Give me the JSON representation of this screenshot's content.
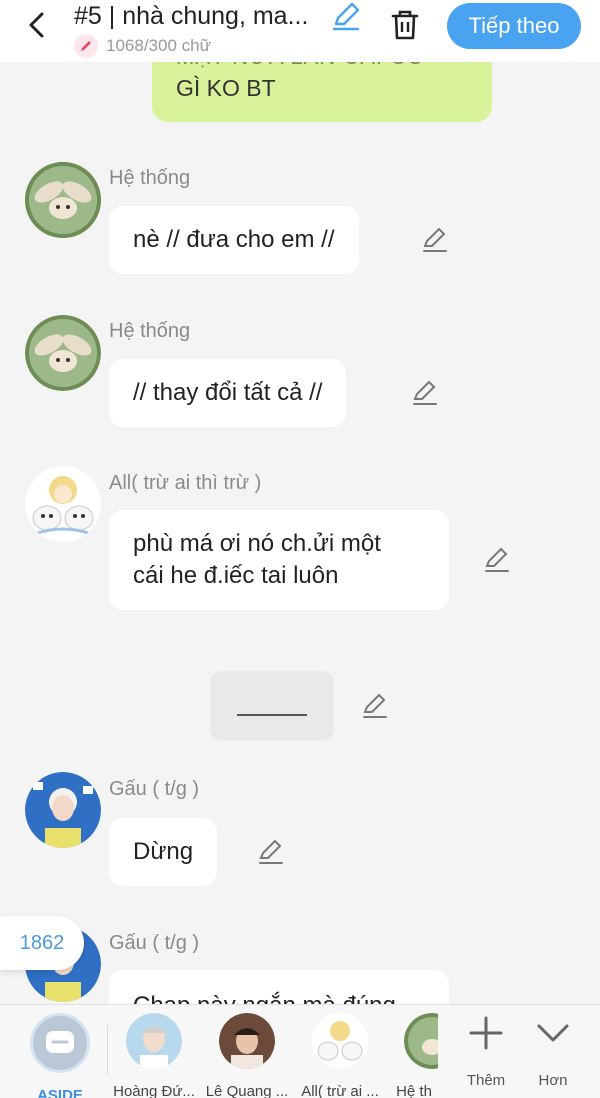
{
  "header": {
    "title": "#5 | nhà chung, ma...",
    "word_count": "1068/300 chữ",
    "next_button": "Tiếp theo"
  },
  "top_bubble": {
    "line1": "MẶT NỮA LẦN CÁI CÓ",
    "line2": "GÌ KO BT"
  },
  "messages": [
    {
      "name": "Hệ thống",
      "text": "nè // đưa cho em //"
    },
    {
      "name": "Hệ thống",
      "text": "// thay đổi tất cả //"
    },
    {
      "name": "All( trừ ai thì trừ )",
      "line1": "phù má ơi nó ch.ửi một",
      "line2": "cái he đ.iếc tai luôn"
    },
    {
      "name": "Gấu ( t/g )",
      "text": "Dừng"
    },
    {
      "name": "Gấu ( t/g )",
      "text": "Chap này ngắn mà đúng"
    }
  ],
  "divider_text": "______",
  "side_counter": "1862",
  "bottom_bar": {
    "characters": [
      {
        "label": "ASIDE"
      },
      {
        "label": "Hoàng Đứ..."
      },
      {
        "label": "Lê Quang ..."
      },
      {
        "label": "All( trừ ai ..."
      },
      {
        "label": "Hệ th"
      }
    ],
    "more_label": "Thêm",
    "less_label": "Hơn"
  },
  "colors": {
    "accent": "#4aa3f0",
    "green_bubble": "#d9f29a",
    "background": "#f4f4f4"
  }
}
